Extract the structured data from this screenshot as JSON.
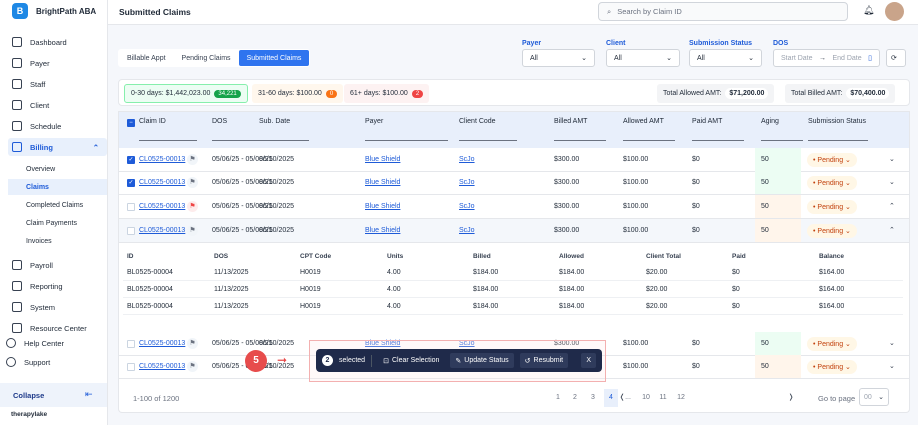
{
  "app": {
    "name": "BrightPath ABA",
    "logo_letter": "B",
    "footer_brand": "therapylake"
  },
  "sidebar": {
    "items": [
      {
        "label": "Dashboard",
        "icon": "dashboard-icon"
      },
      {
        "label": "Payer",
        "icon": "shield-icon"
      },
      {
        "label": "Staff",
        "icon": "staff-icon"
      },
      {
        "label": "Client",
        "icon": "client-icon"
      },
      {
        "label": "Schedule",
        "icon": "calendar-icon"
      },
      {
        "label": "Billing",
        "icon": "billing-icon",
        "active": true
      }
    ],
    "billing_sub": [
      {
        "label": "Overview"
      },
      {
        "label": "Claims",
        "active": true
      },
      {
        "label": "Completed Claims"
      },
      {
        "label": "Claim Payments"
      },
      {
        "label": "Invoices"
      }
    ],
    "items2": [
      {
        "label": "Payroll"
      },
      {
        "label": "Reporting"
      },
      {
        "label": "System"
      },
      {
        "label": "Resource Center"
      }
    ],
    "bottom": [
      {
        "label": "Help Center"
      },
      {
        "label": "Support"
      }
    ],
    "collapse": "Collapse"
  },
  "header": {
    "title": "Submitted Claims",
    "search_placeholder": "Search by Claim ID"
  },
  "tabs": [
    {
      "label": "Billable Appt"
    },
    {
      "label": "Pending Claims"
    },
    {
      "label": "Submitted Claims",
      "active": true
    }
  ],
  "filters": {
    "payer": {
      "label": "Payer",
      "value": "All"
    },
    "client": {
      "label": "Client",
      "value": "All"
    },
    "status": {
      "label": "Submission Status",
      "value": "All"
    },
    "dos": {
      "label": "DOS",
      "start": "Start Date",
      "end": "End Date"
    }
  },
  "summary": {
    "b1": {
      "label": "0-30 days: $1,442,023.00",
      "count": "34,221",
      "color": "#16a34a"
    },
    "b2": {
      "label": "31-60 days: $100.00",
      "count": "0",
      "color": "#f97316"
    },
    "b3": {
      "label": "61+ days: $100.00",
      "count": "2",
      "color": "#ef4444"
    },
    "allowed": {
      "label": "Total Allowed AMT:",
      "value": "$71,200.00"
    },
    "billed": {
      "label": "Total Billed AMT:",
      "value": "$70,400.00"
    }
  },
  "columns": [
    "Claim ID",
    "DOS",
    "Sub. Date",
    "Payer",
    "Client Code",
    "Billed AMT",
    "Allowed AMT",
    "Paid AMT",
    "Aging",
    "Submission Status"
  ],
  "rows": [
    {
      "id": "CL0525-00013",
      "dos": "05/06/25 - 05/08/25",
      "sub": "06/10/2025",
      "payer": "Blue Shield",
      "client": "ScJo",
      "billed": "$300.00",
      "allowed": "$100.00",
      "paid": "$0",
      "aging": "50",
      "status": "Pending",
      "checked": true,
      "flag": "none",
      "aging_tone": "green",
      "expanded": false
    },
    {
      "id": "CL0525-00013",
      "dos": "05/06/25 - 05/08/25",
      "sub": "06/10/2025",
      "payer": "Blue Shield",
      "client": "ScJo",
      "billed": "$300.00",
      "allowed": "$100.00",
      "paid": "$0",
      "aging": "50",
      "status": "Pending",
      "checked": true,
      "flag": "none",
      "aging_tone": "green",
      "expanded": false
    },
    {
      "id": "CL0525-00013",
      "dos": "05/06/25 - 05/08/25",
      "sub": "06/10/2025",
      "payer": "Blue Shield",
      "client": "ScJo",
      "billed": "$300.00",
      "allowed": "$100.00",
      "paid": "$0",
      "aging": "50",
      "status": "Pending",
      "checked": false,
      "flag": "red",
      "aging_tone": "orange",
      "expanded": true
    },
    {
      "id": "CL0525-00013",
      "dos": "05/06/25 - 05/08/25",
      "sub": "06/10/2025",
      "payer": "Blue Shield",
      "client": "ScJo",
      "billed": "$300.00",
      "allowed": "$100.00",
      "paid": "$0",
      "aging": "50",
      "status": "Pending",
      "checked": false,
      "flag": "none",
      "aging_tone": "orange",
      "expanded": true
    },
    {
      "id": "CL0525-00013",
      "dos": "05/06/25 - 05/08/25",
      "sub": "06/10/2025",
      "payer": "Blue Shield",
      "client": "ScJo",
      "billed": "$300.00",
      "allowed": "$100.00",
      "paid": "$0",
      "aging": "50",
      "status": "Pending",
      "checked": false,
      "flag": "none",
      "aging_tone": "green",
      "expanded": false
    },
    {
      "id": "CL0525-00013",
      "dos": "05/06/25 - 05/08/25",
      "sub": "06/10/2025",
      "payer": "Blue Shield",
      "client": "ScJo",
      "billed": "$300.00",
      "allowed": "$100.00",
      "paid": "$0",
      "aging": "50",
      "status": "Pending",
      "checked": false,
      "flag": "none",
      "aging_tone": "orange",
      "expanded": false
    }
  ],
  "detail": {
    "columns": [
      "ID",
      "DOS",
      "CPT Code",
      "Units",
      "Billed",
      "Allowed",
      "Client Total",
      "Paid",
      "Balance"
    ],
    "rows": [
      [
        "BL0525-00004",
        "11/13/2025",
        "H0019",
        "4.00",
        "$184.00",
        "$184.00",
        "$20.00",
        "$0",
        "$164.00"
      ],
      [
        "BL0525-00004",
        "11/13/2025",
        "H0019",
        "4.00",
        "$184.00",
        "$184.00",
        "$20.00",
        "$0",
        "$164.00"
      ],
      [
        "BL0525-00004",
        "11/13/2025",
        "H0019",
        "4.00",
        "$184.00",
        "$184.00",
        "$20.00",
        "$0",
        "$164.00"
      ]
    ]
  },
  "footer": {
    "range": "1-100 of 1200",
    "pages": [
      "1",
      "2",
      "3",
      "4",
      "...",
      "10",
      "11",
      "12"
    ],
    "current_page": "4",
    "goto_label": "Go to page",
    "goto_value": "00"
  },
  "action_bar": {
    "count": "2",
    "selected": "selected",
    "clear": "Clear Selection",
    "update": "Update Status",
    "resubmit": "Resubmit",
    "close": "X"
  },
  "annotation": {
    "step": "5"
  }
}
